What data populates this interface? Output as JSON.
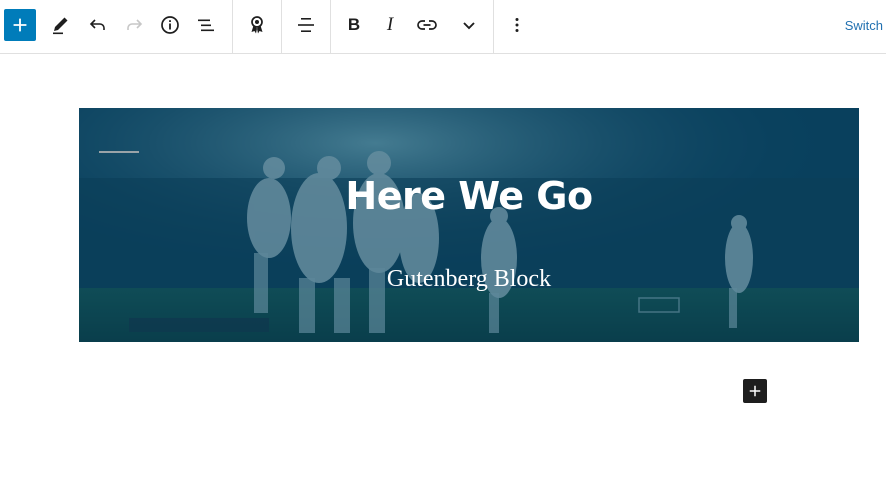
{
  "toolbar": {
    "inserter_icon": "plus-icon",
    "tools_icon": "pencil-icon",
    "undo_icon": "undo-icon",
    "redo_icon": "redo-icon",
    "details_icon": "info-icon",
    "list_view_icon": "list-view-icon",
    "block_icon": "award-icon",
    "align_icon": "align-center-icon",
    "bold_label": "B",
    "italic_label": "I",
    "link_icon": "link-icon",
    "more_icon": "chevron-down-icon",
    "options_icon": "vertical-ellipsis-icon",
    "switch_label": "Switch"
  },
  "cover": {
    "title": "Here We Go",
    "subtitle": "Gutenberg Block",
    "overlay_color": "#064260"
  },
  "appender": {
    "icon": "plus-icon"
  },
  "colors": {
    "accent": "#007cba",
    "link": "#2271b1",
    "text": "#1e1e1e"
  }
}
